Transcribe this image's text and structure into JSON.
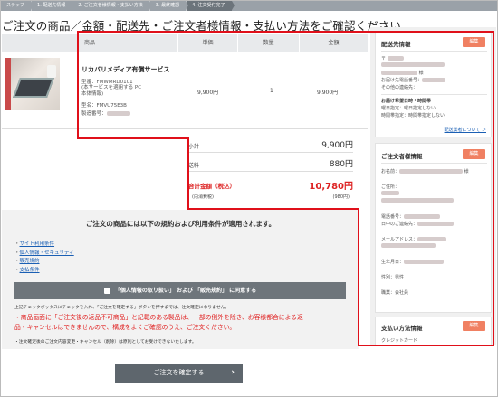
{
  "steps": [
    "ステップ",
    "1. 配送先情報",
    "2. ご注文者様情報・支払い方法",
    "3. 最終確認",
    "4. 注文受付完了"
  ],
  "page_title": "ご注文の商品／金額・配送先・ご注文者様情報・支払い方法をご確認ください。",
  "table": {
    "headers": {
      "product": "商品",
      "price": "単価",
      "qty": "数量",
      "amount": "金額"
    },
    "row": {
      "name": "リカバリメディア有償サービス",
      "model_no": "型番：FMWMRD0101",
      "note": "(本サービスを適用する PC本体情報)",
      "model_name": "型名：FMVU75E3B",
      "serial_label": "製造番号：",
      "price": "9,900円",
      "qty": "1",
      "amount": "9,900円"
    }
  },
  "totals": {
    "subtotal_label": "小計",
    "subtotal": "9,900円",
    "shipping_label": "送料",
    "shipping": "880円",
    "grand_label": "合計金額（税込）",
    "grand": "10,780円",
    "tax_label": "(内消費税)",
    "tax": "(980円)"
  },
  "terms": {
    "title": "ご注文の商品には以下の規約および利用条件が適用されます。",
    "links": [
      "サイト利用条件",
      "個人情報・セキュリティ",
      "販売規約",
      "支払条件"
    ],
    "agree": "「個人情報の取り扱い」 および 「販売規約」 に同意する",
    "note1": "上記チェックボックスにチェックを入れ、「ご注文を確定する」ボタンを押すまでは、注文確定になりません。",
    "red1": "・商品画面に「ご注文後の返品不可商品」と記載のある製品は、一部の例外を除き、お客様都合による返",
    "red2": "品・キャンセルはできませんので、構成をよくご確認のうえ、ご注文ください。",
    "note2": "・注文確定後のご注文内容変更・キャンセル（削除）は原則としてお受けできないたします。"
  },
  "confirm_button": "ご注文を確定する",
  "sidebar": {
    "edit_label": "編集",
    "shipping": {
      "title": "配送先情報",
      "postal": "〒",
      "name_suffix": "様",
      "phone_label": "お届け先電話番号：",
      "other_label": "その他の連絡先：",
      "delivery_label": "お届け希望日時・時間帯",
      "date": "曜日指定：曜日指定しない",
      "time": "時間帯指定：時間帯指定しない",
      "link": "配送業者について ＞"
    },
    "orderer": {
      "title": "ご注文者様情報",
      "name_label": "お名前：",
      "name_suffix": "様",
      "address_label": "ご住所：",
      "phone_label": "電話番号：",
      "day_label": "日中のご連絡先：",
      "email_label": "メールアドレス：",
      "birth_label": "生年月日：",
      "gender": "性別：男性",
      "job": "職業：会社員"
    },
    "payment": {
      "title": "支払い方法情報",
      "method": "クレジットカード"
    }
  }
}
